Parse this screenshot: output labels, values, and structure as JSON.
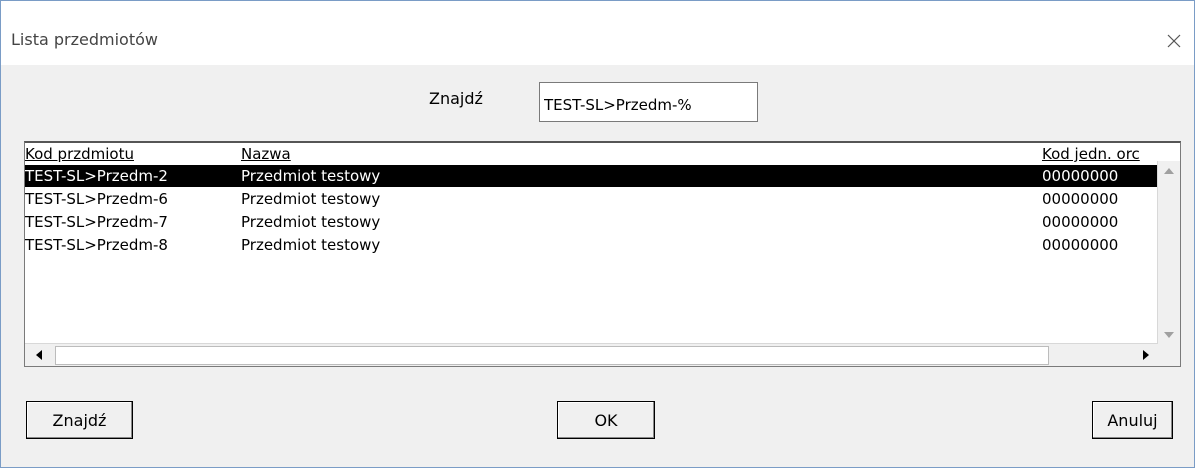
{
  "window": {
    "title": "Lista przedmiotów"
  },
  "search": {
    "label": "Znajdź",
    "value": "TEST-SL>Przedm-%"
  },
  "table": {
    "headers": [
      "Kod przdmiotu",
      "Nazwa",
      "Kod jedn. orc"
    ],
    "rows": [
      {
        "code": "TEST-SL>Przedm-2",
        "name": "Przedmiot testowy",
        "unit": "00000000",
        "selected": true
      },
      {
        "code": "TEST-SL>Przedm-6",
        "name": "Przedmiot testowy",
        "unit": "00000000",
        "selected": false
      },
      {
        "code": "TEST-SL>Przedm-7",
        "name": "Przedmiot testowy",
        "unit": "00000000",
        "selected": false
      },
      {
        "code": "TEST-SL>Przedm-8",
        "name": "Przedmiot testowy",
        "unit": "00000000",
        "selected": false
      }
    ]
  },
  "buttons": {
    "find": "Znajdź",
    "ok": "OK",
    "cancel": "Anuluj"
  },
  "icons": {
    "close": "close-icon",
    "scroll_up": "arrow-up-icon",
    "scroll_down": "arrow-down-icon",
    "scroll_left": "arrow-left-icon",
    "scroll_right": "arrow-right-icon"
  },
  "colors": {
    "selection_bg": "#000000",
    "selection_fg": "#ffffff",
    "dialog_bg": "#f0f0f0"
  }
}
